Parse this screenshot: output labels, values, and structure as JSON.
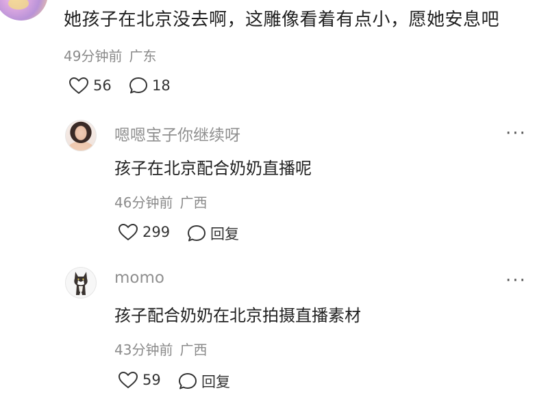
{
  "top_comment": {
    "text": "她孩子在北京没去啊，这雕像看着有点小，愿她安息吧",
    "time": "49分钟前",
    "region": "广东",
    "likes": "56",
    "replies": "18"
  },
  "replies": [
    {
      "username": "嗯嗯宝子你继续呀",
      "text": "孩子在北京配合奶奶直播呢",
      "time": "46分钟前",
      "region": "广西",
      "likes": "299",
      "reply_label": "回复",
      "more": "···"
    },
    {
      "username": "momo",
      "text": "孩子配合奶奶在北京拍摄直播素材",
      "time": "43分钟前",
      "region": "广西",
      "likes": "59",
      "reply_label": "回复",
      "more": "···"
    }
  ],
  "icons": {
    "like": "heart-outline",
    "comment": "speech-bubble-outline",
    "more": "ellipsis"
  },
  "colors": {
    "text": "#1f1f1f",
    "meta": "#8a8a8a",
    "username": "#8f8f8f"
  }
}
